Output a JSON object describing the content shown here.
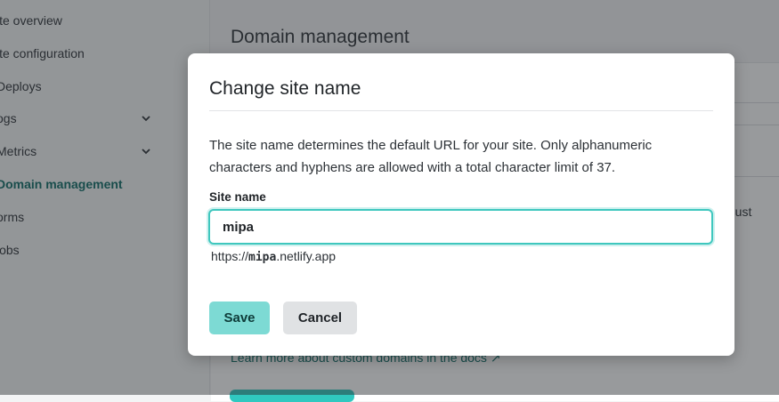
{
  "sidebar": {
    "items": [
      {
        "label": "ite overview",
        "chevron": false,
        "active": false
      },
      {
        "label": "ite configuration",
        "chevron": false,
        "active": false
      },
      {
        "label": "Deploys",
        "chevron": false,
        "active": false
      },
      {
        "label": "ogs",
        "chevron": true,
        "active": false
      },
      {
        "label": "Metrics",
        "chevron": true,
        "active": false
      },
      {
        "label": "Domain management",
        "chevron": false,
        "active": true
      },
      {
        "label": "orms",
        "chevron": false,
        "active": false
      },
      {
        "label": "lobs",
        "chevron": false,
        "active": false
      }
    ]
  },
  "main": {
    "heading": "Domain management",
    "right_fragment": "e. Cust",
    "docs_link": "Learn more about custom domains in the docs ↗"
  },
  "modal": {
    "title": "Change site name",
    "description": "The site name determines the default URL for your site. Only alphanumeric characters and hyphens are allowed with a total character limit of 37.",
    "field_label": "Site name",
    "field_value": "mipa",
    "url_prefix": "https://",
    "url_slug": "mipa",
    "url_suffix": ".netlify.app",
    "save_label": "Save",
    "cancel_label": "Cancel"
  },
  "colors": {
    "accent": "#3fc7be",
    "save_bg": "#7ddad4",
    "active_nav": "#0d6b66"
  }
}
